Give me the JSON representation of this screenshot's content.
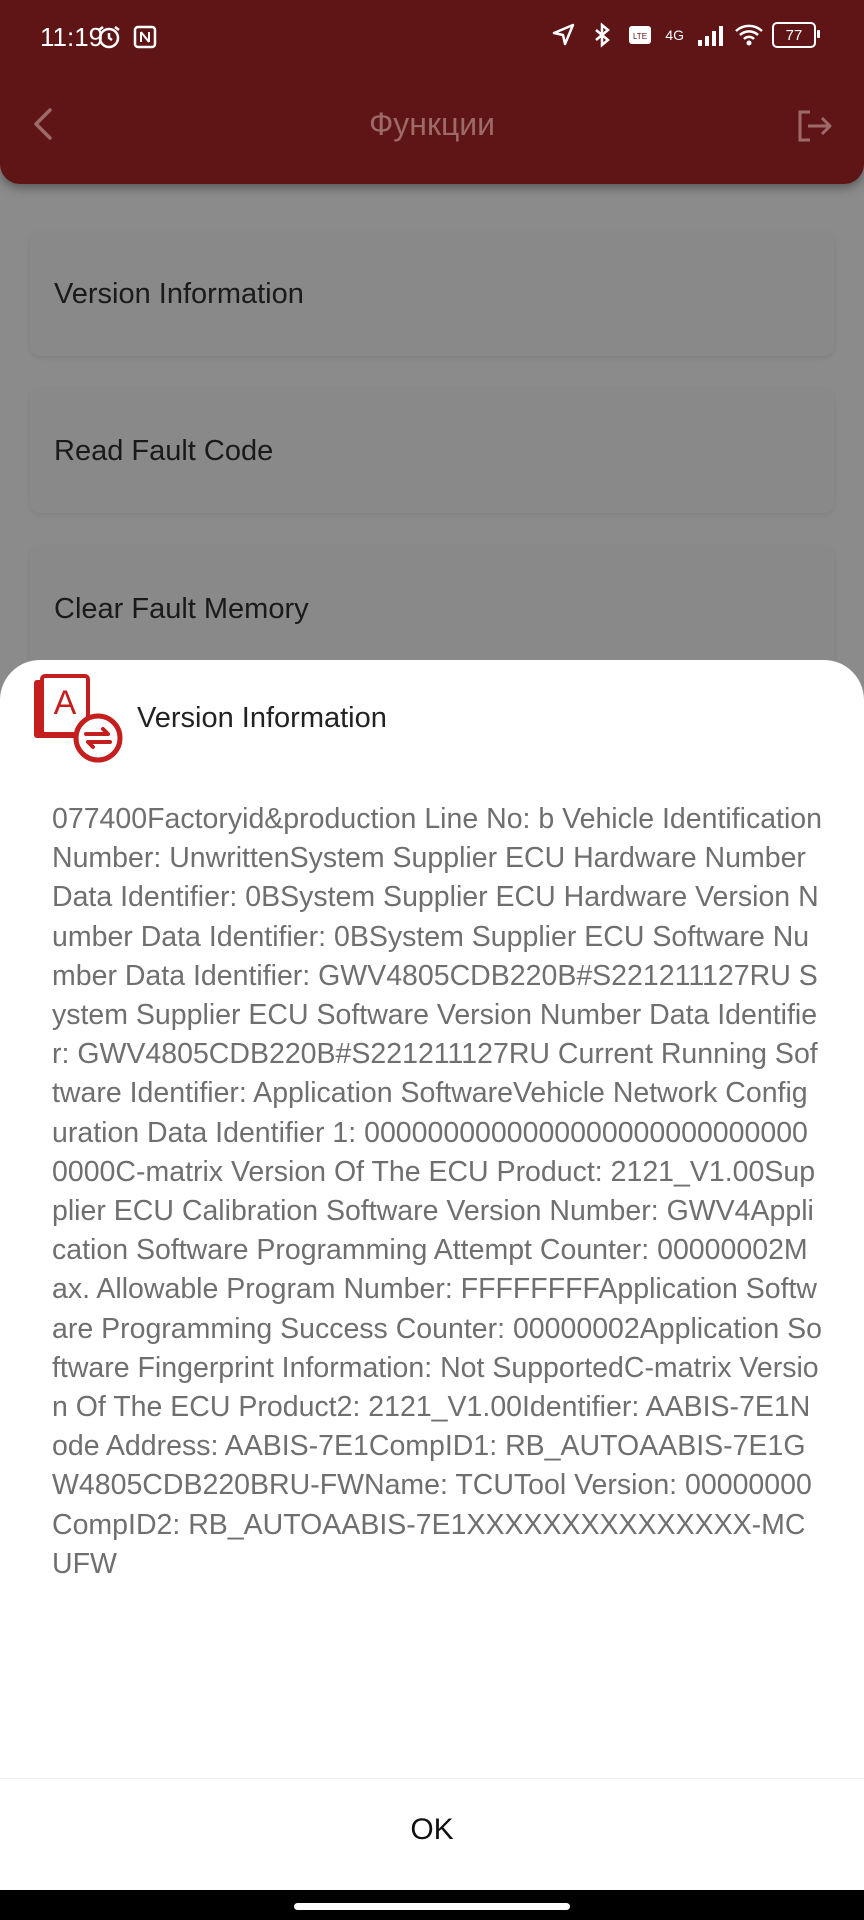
{
  "status_bar": {
    "time": "11:19",
    "battery": "77",
    "network": "4G",
    "icons": [
      "alarm-icon",
      "nfc-icon",
      "location-icon",
      "bluetooth-icon",
      "volte-icon",
      "signal-icon",
      "wifi-icon",
      "battery-icon"
    ]
  },
  "header": {
    "title": "Функции",
    "back_icon": "chevron-left-icon",
    "exit_icon": "logout-icon",
    "color": "#8b1d1d"
  },
  "menu": {
    "items": [
      {
        "label": "Version Information"
      },
      {
        "label": "Read Fault Code"
      },
      {
        "label": "Clear Fault Memory"
      }
    ]
  },
  "dialog": {
    "title": "Version Information",
    "icon": "ecu-info-icon",
    "body": "077400Factoryid&production Line No:  b           Vehicle Identification Number: UnwrittenSystem Supplier ECU Hardware Number Data Identifier: 0BSystem Supplier ECU Hardware Version Number Data Identifier: 0BSystem Supplier ECU Software Number Data Identifier: GWV4805CDB220B#S221211127RU System Supplier ECU Software Version Number Data Identifier: GWV4805CDB220B#S221211127RU Current Running Software Identifier: Application SoftwareVehicle Network Configuration Data Identifier 1: 00000000000000000000000000000000C-matrix Version Of The ECU Product: 2121_V1.00Supplier ECU Calibration Software Version Number: GWV4Application Software Programming Attempt Counter: 00000002Max. Allowable Program Number: FFFFFFFFApplication Software Programming Success Counter: 00000002Application Software Fingerprint Information: Not SupportedC-matrix Version Of The ECU Product2: 2121_V1.00Identifier: AABIS-7E1Node Address: AABIS-7E1CompID1: RB_AUTOAABIS-7E1GW4805CDB220BRU-FWName: TCUTool Version: 00000000CompID2: RB_AUTOAABIS-7E1XXXXXXXXXXXXXXX-MCUFW",
    "ok_label": "OK"
  }
}
